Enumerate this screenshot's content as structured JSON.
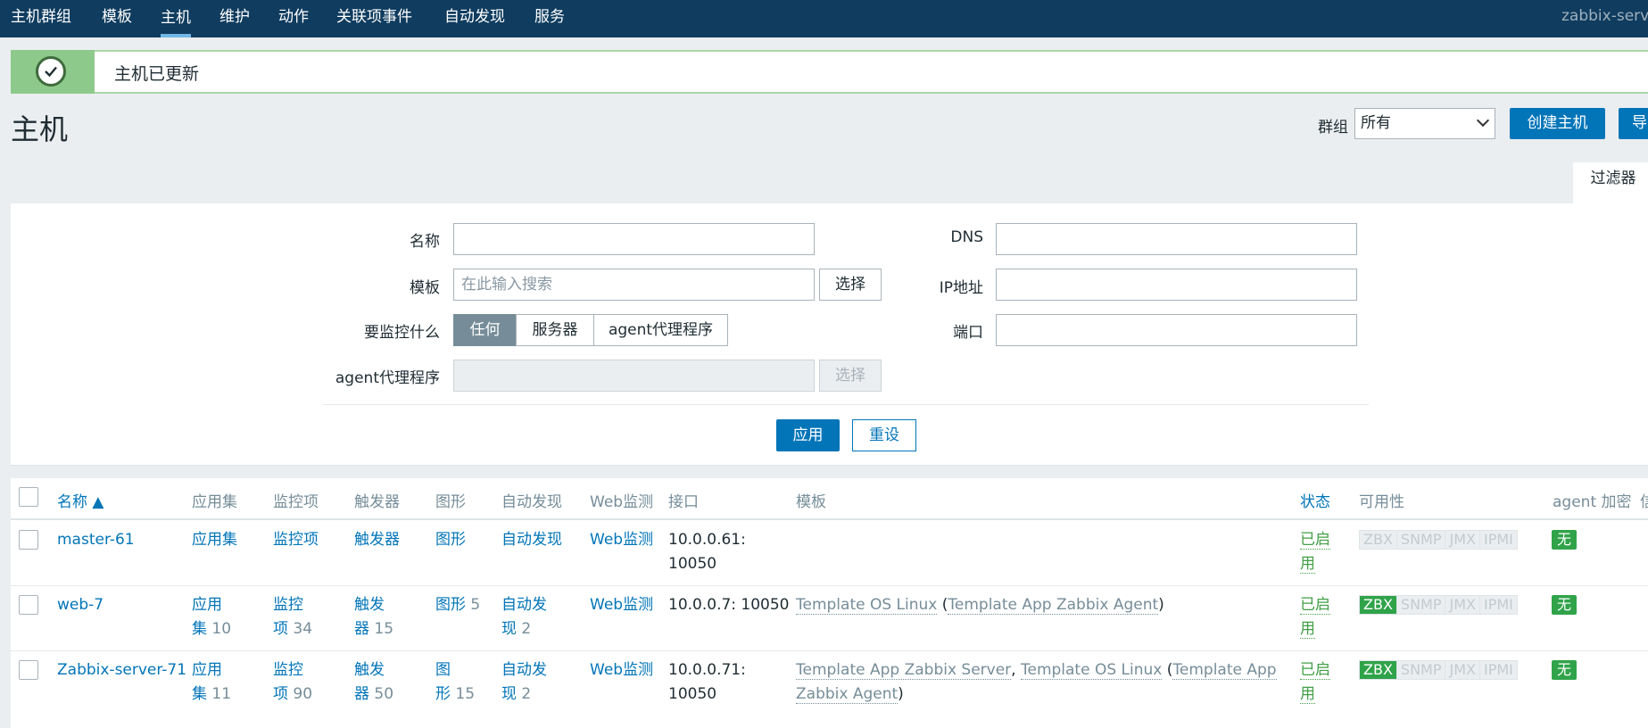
{
  "nav": {
    "items": [
      "主机群组",
      "模板",
      "主机",
      "维护",
      "动作",
      "关联项事件",
      "自动发现",
      "服务"
    ],
    "brand": "zabbix-serve"
  },
  "message": {
    "text": "主机已更新",
    "icon": "check-icon"
  },
  "header": {
    "title": "主机",
    "group_label": "群组",
    "group_value": "所有",
    "create_button": "创建主机",
    "import_button": "导"
  },
  "filter": {
    "tab_label": "过滤器",
    "name_label": "名称",
    "name_value": "",
    "template_label": "模板",
    "template_placeholder": "在此输入搜索",
    "template_select": "选择",
    "monitor_label": "要监控什么",
    "monitor_options": [
      "任何",
      "服务器",
      "agent代理程序"
    ],
    "monitor_selected": "任何",
    "proxy_label": "agent代理程序",
    "proxy_select": "选择",
    "dns_label": "DNS",
    "dns_value": "",
    "ip_label": "IP地址",
    "ip_value": "",
    "port_label": "端口",
    "port_value": "",
    "apply": "应用",
    "reset": "重设"
  },
  "table": {
    "columns": [
      "名称 ▲",
      "应用集",
      "监控项",
      "触发器",
      "图形",
      "自动发现",
      "Web监测",
      "接口",
      "模板",
      "状态",
      "可用性",
      "agent 加密",
      "信"
    ],
    "rows": [
      {
        "name": "master-61",
        "apps": {
          "label": "应用集",
          "count": ""
        },
        "items": {
          "label": "监控项",
          "count": ""
        },
        "triggers": {
          "label": "触发器",
          "count": ""
        },
        "graphs": {
          "label": "图形",
          "count": ""
        },
        "discovery": {
          "label": "自动发现",
          "count": ""
        },
        "web": "Web监测",
        "iface_l1": "10.0.0.61:",
        "iface_l2": "10050",
        "tpl_l1": [],
        "tpl_l2": [],
        "status_l1": "已启",
        "status_l2": "用",
        "zbx_ok": false,
        "enc": "无"
      },
      {
        "name": "web-7",
        "apps": {
          "label1": "应用",
          "label2": "集",
          "count": "10"
        },
        "items": {
          "label1": "监控",
          "label2": "项",
          "count": "34"
        },
        "triggers": {
          "label1": "触发",
          "label2": "器",
          "count": "15"
        },
        "graphs": {
          "label": "图形",
          "count": "5"
        },
        "discovery": {
          "label1": "自动发",
          "label2": "现",
          "count": "2"
        },
        "web": "Web监测",
        "iface_l1": "10.0.0.7: 10050",
        "iface_l2": "",
        "zbx_ok": true,
        "enc": "无"
      },
      {
        "name": "Zabbix-server-71",
        "apps": {
          "label1": "应用",
          "label2": "集",
          "count": "11"
        },
        "items": {
          "label1": "监控",
          "label2": "项",
          "count": "90"
        },
        "triggers": {
          "label1": "触发",
          "label2": "器",
          "count": "50"
        },
        "graphs": {
          "label1": "图",
          "label2": "形",
          "count": "15"
        },
        "discovery": {
          "label1": "自动发",
          "label2": "现",
          "count": "2"
        },
        "web": "Web监测",
        "iface_l1": "10.0.0.71:",
        "iface_l2": "10050",
        "zbx_ok": true,
        "enc": "无"
      }
    ],
    "row2_templates": {
      "t1": "Template OS Linux",
      "t2": "Template App Zabbix Agent"
    },
    "row3_templates": {
      "t1": "Template App Zabbix Server",
      "t2": "Template OS Linux",
      "t3a": "Template App",
      "t3b": "Zabbix Agent"
    },
    "status_l1": "已启",
    "status_l2": "用",
    "avail_badges": [
      "ZBX",
      "SNMP",
      "JMX",
      "IPMI"
    ]
  },
  "colors": {
    "nav_bg": "#0f3c5f",
    "primary": "#0275b8",
    "success": "#30a34a",
    "status_enabled": "#429e47",
    "msg_green": "#8dc98b"
  }
}
